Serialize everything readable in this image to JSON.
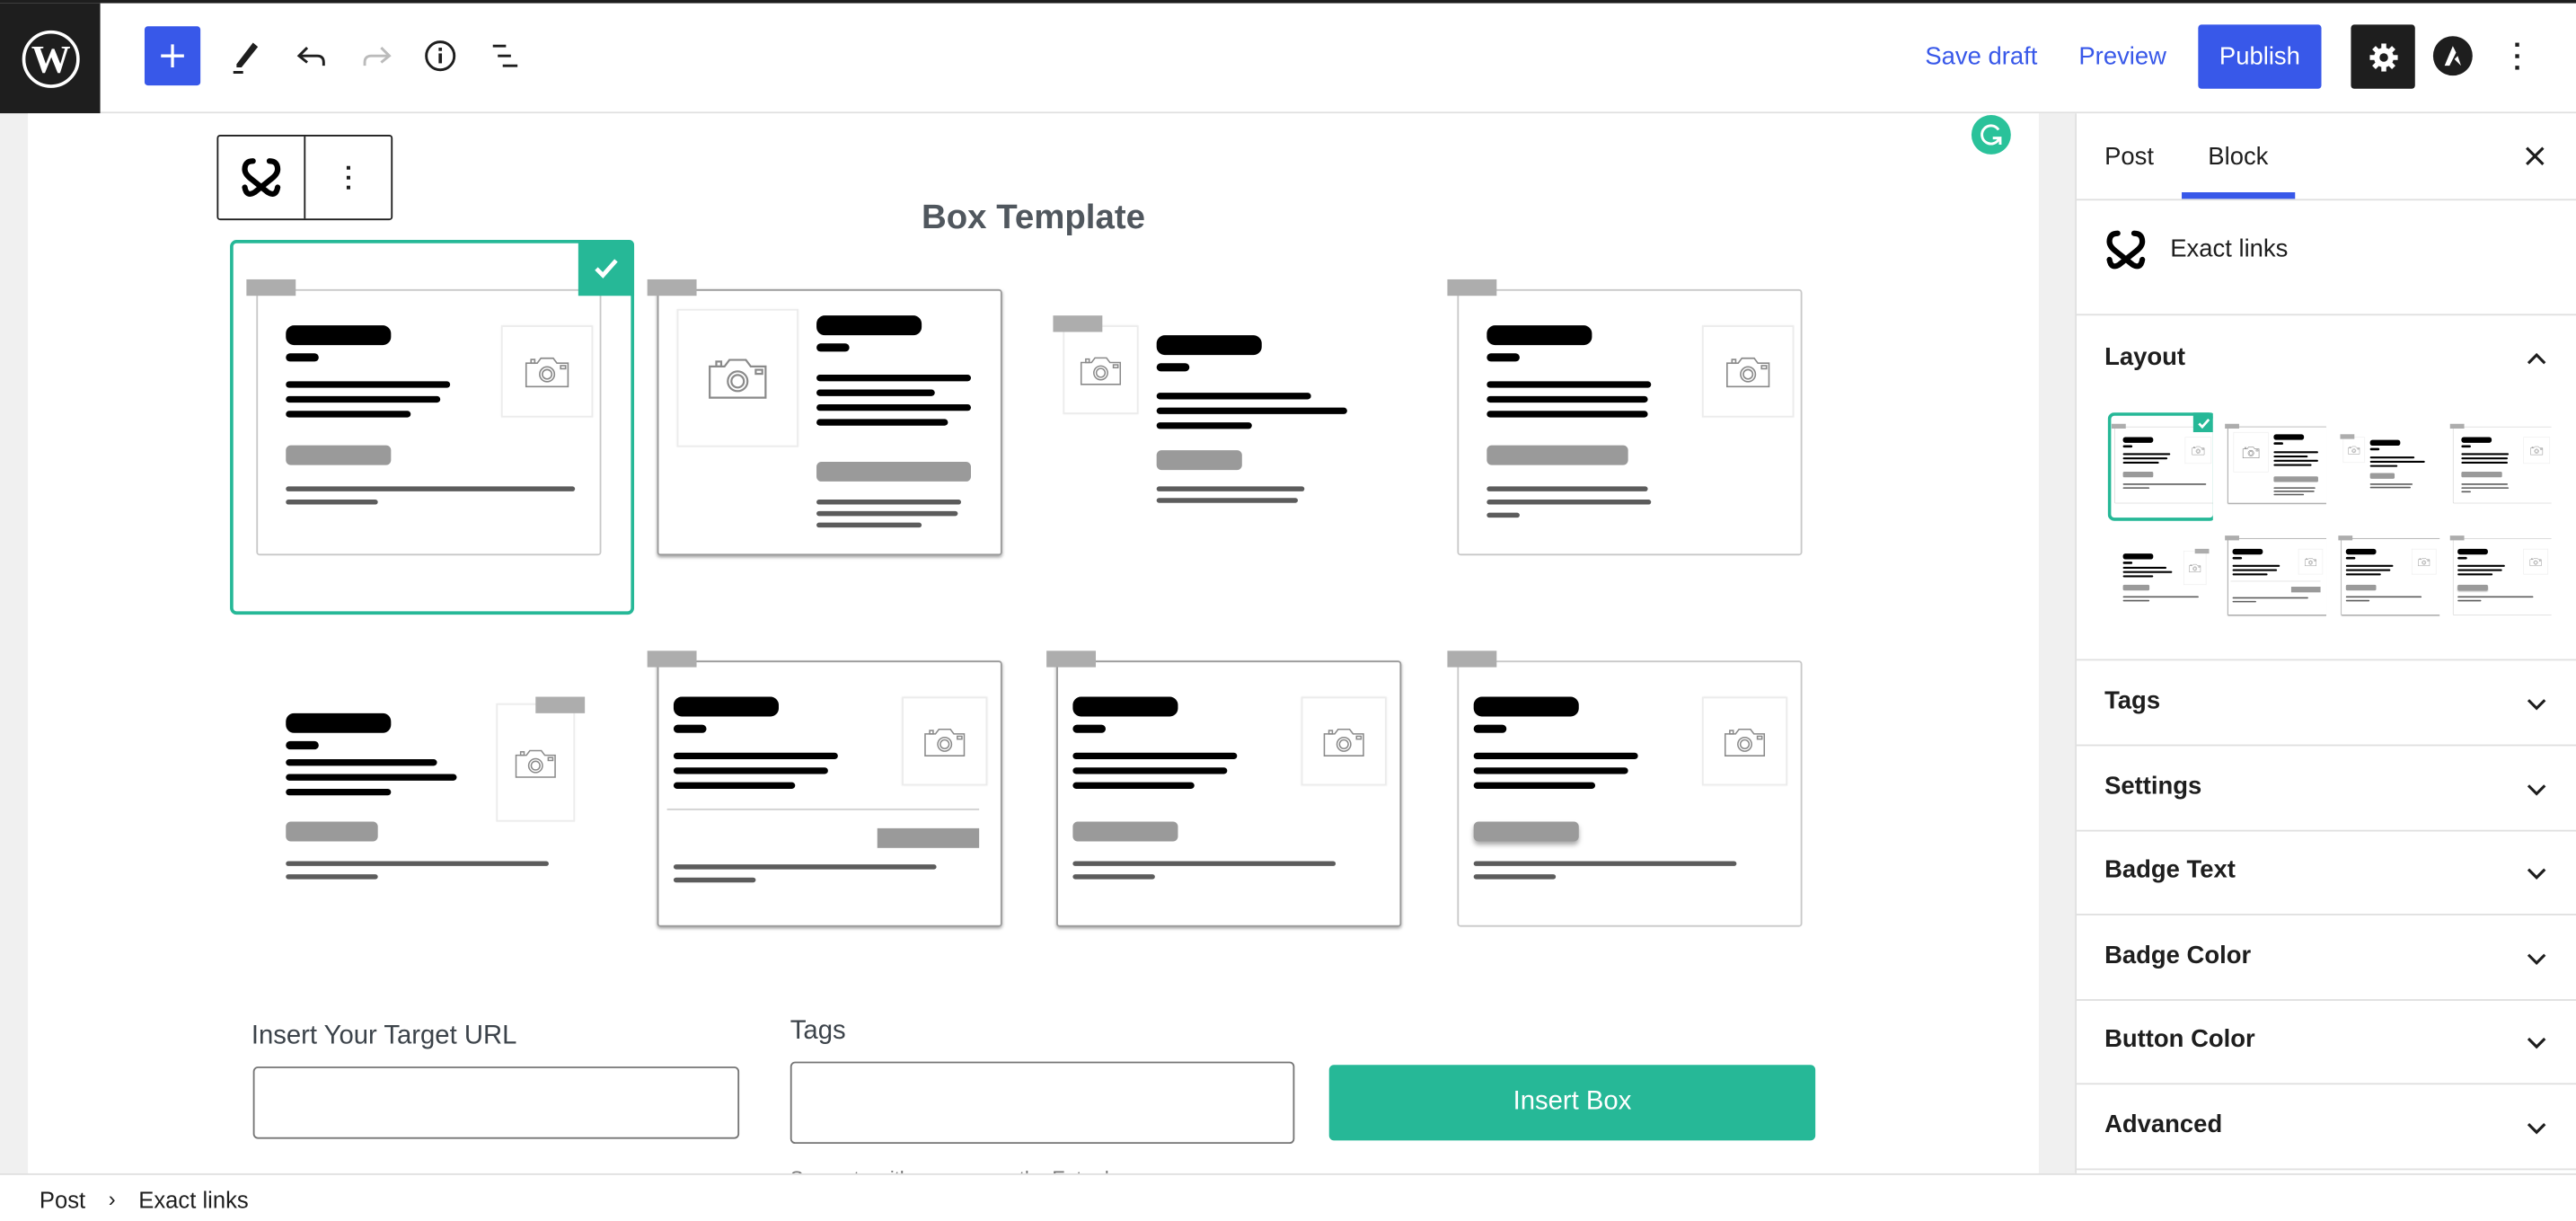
{
  "header": {
    "logo": "wordpress-logo",
    "add_block_label": "+",
    "save_draft": "Save draft",
    "preview": "Preview",
    "publish": "Publish",
    "icons": [
      "plus-icon",
      "pencil-icon",
      "undo-icon",
      "redo-icon",
      "info-icon",
      "list-view-icon",
      "gear-icon",
      "astra-icon",
      "more-vertical-icon"
    ],
    "accent_color": "#3858e9"
  },
  "canvas": {
    "block_name": "Exact links",
    "title": "Box Template",
    "selected_template": 1,
    "templates": [
      {
        "id": 1,
        "variant": "image-right-card"
      },
      {
        "id": 2,
        "variant": "image-left-card-shadow"
      },
      {
        "id": 3,
        "variant": "image-left-plain"
      },
      {
        "id": 4,
        "variant": "image-right-card-tall"
      },
      {
        "id": 5,
        "variant": "image-right-plain-badge-right"
      },
      {
        "id": 6,
        "variant": "image-right-card-divider"
      },
      {
        "id": 7,
        "variant": "image-right-card-shadow"
      },
      {
        "id": 8,
        "variant": "image-right-card-button-shadow"
      }
    ],
    "accent_color": "#26b897",
    "form": {
      "url_label": "Insert Your Target URL",
      "url_value": "",
      "tags_label": "Tags",
      "tags_value": "",
      "tags_help": "Separate with commas or the Enter key.",
      "insert_button": "Insert Box"
    }
  },
  "sidebar": {
    "tabs": [
      {
        "label": "Post",
        "active": false
      },
      {
        "label": "Block",
        "active": true
      }
    ],
    "block_name": "Exact links",
    "layout_title": "Layout",
    "panels": [
      "Tags",
      "Settings",
      "Badge Text",
      "Badge Color",
      "Button Color",
      "Advanced"
    ]
  },
  "footer": {
    "breadcrumb": [
      "Post",
      "Exact links"
    ]
  }
}
